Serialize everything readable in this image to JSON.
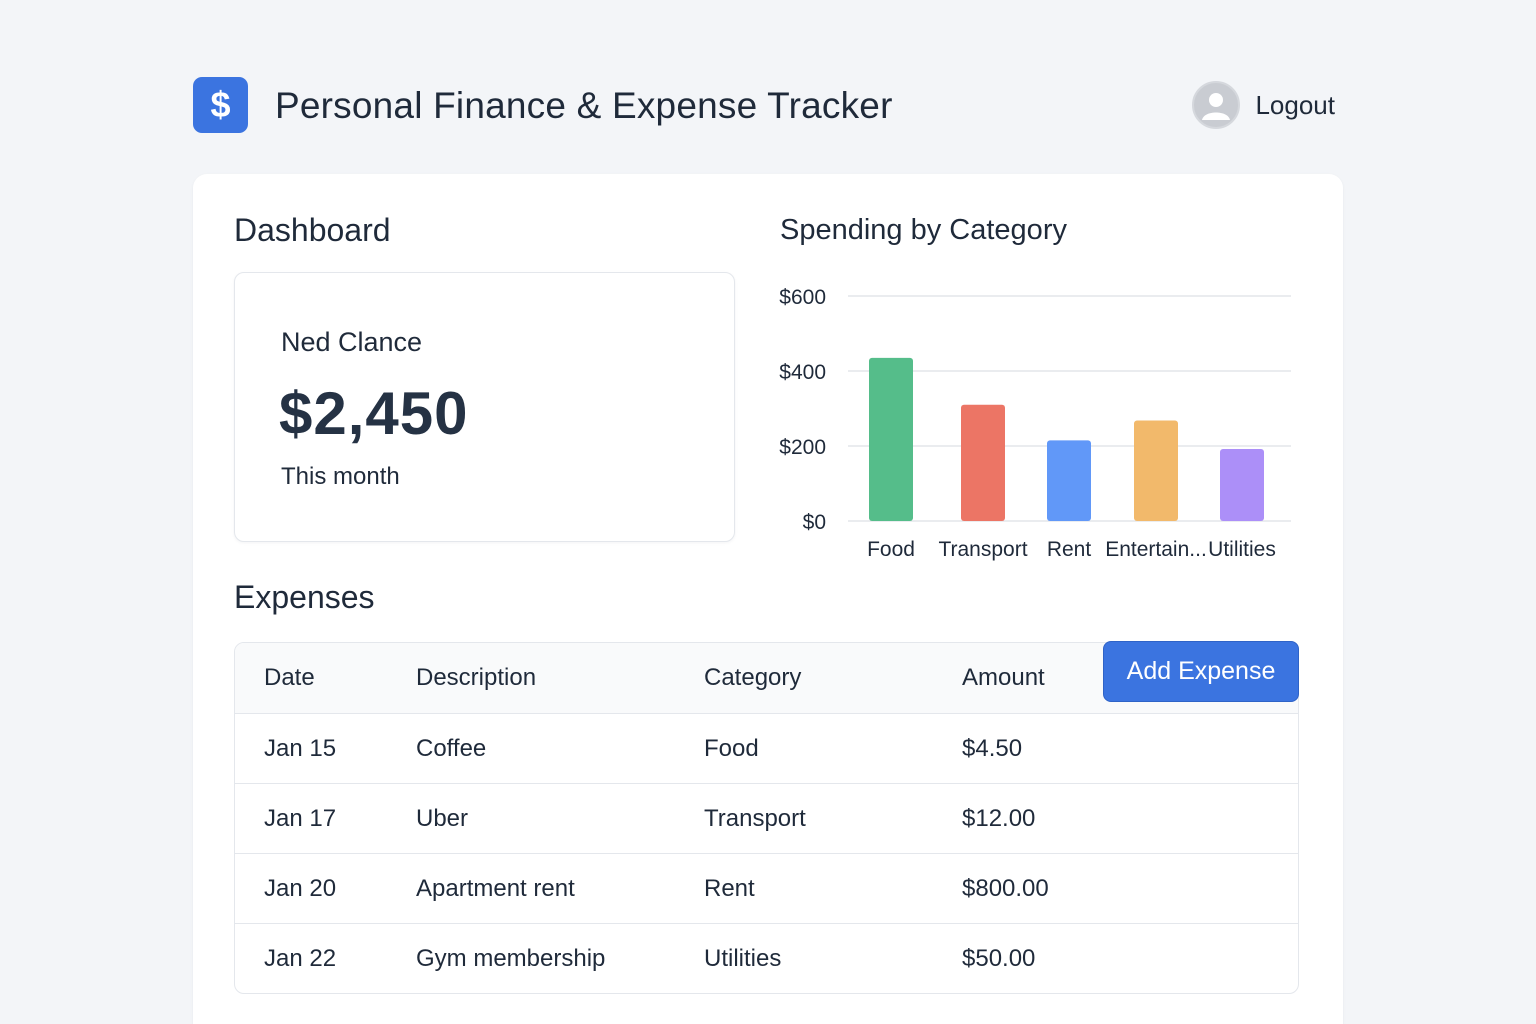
{
  "header": {
    "logo_symbol": "$",
    "title": "Personal Finance & Expense Tracker",
    "logout_label": "Logout"
  },
  "dashboard": {
    "title": "Dashboard",
    "user_name": "Ned Clance",
    "total": "$2,450",
    "period_caption": "This month"
  },
  "chart_data": {
    "type": "bar",
    "title": "Spending by Category",
    "categories": [
      "Food",
      "Transport",
      "Rent",
      "Entertain...",
      "Utilities"
    ],
    "values": [
      435,
      310,
      215,
      268,
      192
    ],
    "colors": [
      "#55bd8a",
      "#ec7565",
      "#6198f8",
      "#f2b96b",
      "#ac8ff8"
    ],
    "yticks": [
      0,
      200,
      400,
      600
    ],
    "ytick_labels": [
      "$0",
      "$200",
      "$400",
      "$600"
    ],
    "ylim": [
      0,
      600
    ],
    "grid": true
  },
  "expenses": {
    "title": "Expenses",
    "add_button_label": "Add Expense",
    "columns": [
      "Date",
      "Description",
      "Category",
      "Amount"
    ],
    "rows": [
      [
        "Jan 15",
        "Coffee",
        "Food",
        "$4.50"
      ],
      [
        "Jan 17",
        "Uber",
        "Transport",
        "$12.00"
      ],
      [
        "Jan 20",
        "Apartment rent",
        "Rent",
        "$800.00"
      ],
      [
        "Jan 22",
        "Gym membership",
        "Utilities",
        "$50.00"
      ]
    ]
  }
}
